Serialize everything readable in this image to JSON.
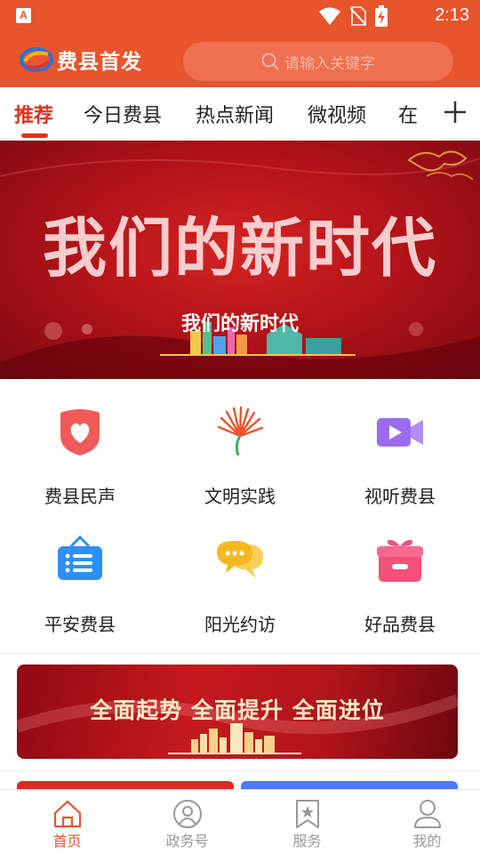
{
  "status_bar": {
    "time": "2:13",
    "notification_icon": "A",
    "icons": [
      "wifi-icon",
      "no-sim-icon",
      "battery-charging-icon"
    ]
  },
  "header": {
    "logo_text": "费县首发",
    "search": {
      "placeholder": "请输入关键字",
      "icon": "search-icon"
    }
  },
  "tabs": {
    "items": [
      {
        "label": "推荐",
        "active": true
      },
      {
        "label": "今日费县",
        "active": false
      },
      {
        "label": "热点新闻",
        "active": false
      },
      {
        "label": "微视频",
        "active": false
      },
      {
        "label": "在",
        "active": false
      }
    ],
    "add_icon": "plus-icon"
  },
  "banner": {
    "headline": "我们的新时代",
    "caption": "我们的新时代"
  },
  "shortcuts": [
    {
      "label": "费县民声",
      "icon": "heart-shield-icon",
      "color": "#F25A5A"
    },
    {
      "label": "文明实践",
      "icon": "fan-icon",
      "color": "#E8542C"
    },
    {
      "label": "视听费县",
      "icon": "video-camera-icon",
      "color": "#9B6CF0"
    },
    {
      "label": "平安费县",
      "icon": "notice-board-icon",
      "color": "#2E8FF5"
    },
    {
      "label": "阳光约访",
      "icon": "chat-bubbles-icon",
      "color": "#F5B820"
    },
    {
      "label": "好品费县",
      "icon": "gift-box-icon",
      "color": "#F4507A"
    }
  ],
  "slogan_banner": {
    "text": "全面起势 全面提升 全面进位"
  },
  "bottom_nav": [
    {
      "label": "首页",
      "icon": "home-icon",
      "active": true
    },
    {
      "label": "政务号",
      "icon": "badge-icon",
      "active": false
    },
    {
      "label": "服务",
      "icon": "bookmark-star-icon",
      "active": false
    },
    {
      "label": "我的",
      "icon": "user-icon",
      "active": false
    }
  ],
  "colors": {
    "brand": "#E8542C",
    "active_tab": "#E0321E",
    "inactive_nav": "#999999"
  }
}
